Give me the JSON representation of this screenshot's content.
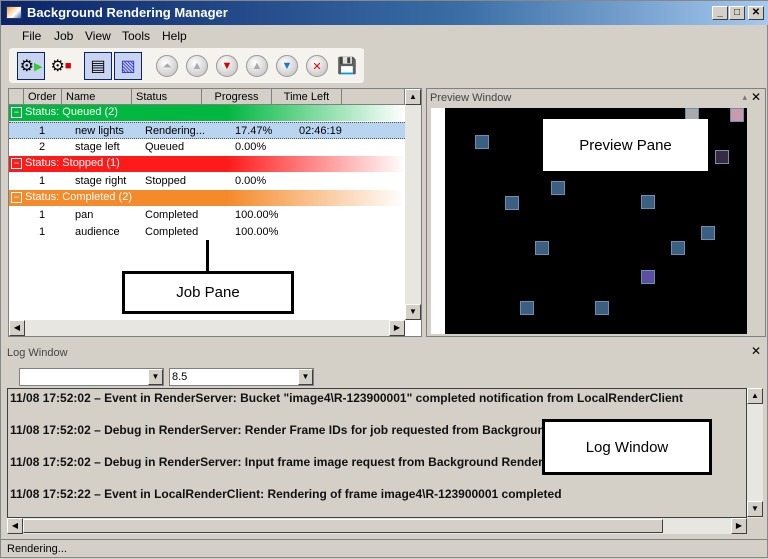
{
  "window": {
    "title": "Background Rendering Manager",
    "min": "_",
    "max": "□",
    "close": "✕"
  },
  "menu": [
    "File",
    "Job",
    "View",
    "Tools",
    "Help"
  ],
  "jobs": {
    "columns": [
      "Order",
      "Name",
      "Status",
      "Progress",
      "Time Left"
    ],
    "groups": [
      {
        "label": "Status: Queued  (2)",
        "color": "#00b840",
        "rows": [
          [
            "1",
            "new lights",
            "Rendering...",
            "17.47%",
            "02:46:19"
          ],
          [
            "2",
            "stage left",
            "Queued",
            "0.00%",
            ""
          ]
        ]
      },
      {
        "label": "Status: Stopped  (1)",
        "color": "#ff1a1a",
        "rows": [
          [
            "1",
            "stage right",
            "Stopped",
            "0.00%",
            ""
          ]
        ]
      },
      {
        "label": "Status: Completed  (2)",
        "color": "#f58a2a",
        "rows": [
          [
            "1",
            "pan",
            "Completed",
            "100.00%",
            ""
          ],
          [
            "1",
            "audience",
            "Completed",
            "100.00%",
            ""
          ]
        ]
      }
    ]
  },
  "preview": {
    "title": "Preview Window"
  },
  "callouts": {
    "job": "Job Pane",
    "preview": "Preview Pane",
    "log": "Log Window"
  },
  "log": {
    "title": "Log Window",
    "combo1": "",
    "combo2": "8.5",
    "lines": [
      "11/08 17:52:02 – Event in RenderServer: Bucket \"image4\\R-123900001\" completed notification from LocalRenderClient",
      "11/08 17:52:02 – Debug in RenderServer: Render Frame IDs for job requested from Background Rendering Manager",
      "11/08 17:52:02 – Debug in RenderServer: Input frame image request from Background Rendering Manager console",
      "11/08 17:52:22 – Event in LocalRenderClient: Rendering of frame image4\\R-123900001 completed"
    ]
  },
  "status": "Rendering..."
}
